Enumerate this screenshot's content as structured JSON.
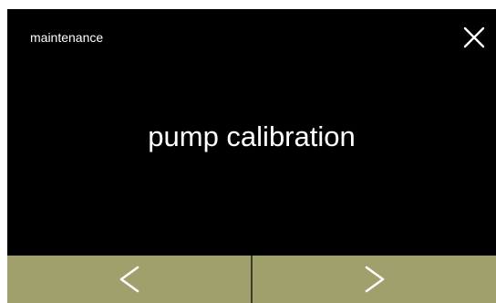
{
  "header": {
    "title": "maintenance",
    "close_icon": "close-icon"
  },
  "main": {
    "title": "pump calibration"
  },
  "nav": {
    "prev_icon": "chevron-left-icon",
    "next_icon": "chevron-right-icon"
  },
  "colors": {
    "background": "#000000",
    "text": "#ffffff",
    "nav_button": "#a0a06c",
    "nav_divider": "#3c3c2a"
  }
}
